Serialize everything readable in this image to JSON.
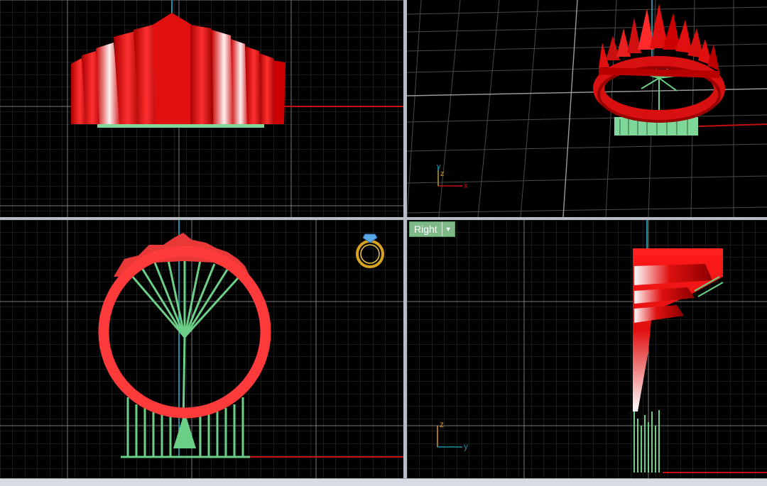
{
  "viewports": {
    "right": {
      "label": "Right",
      "menu_icon": "chevron-down-icon"
    }
  },
  "axis_labels": {
    "perspective": {
      "y": "y",
      "z": "z",
      "x": "x"
    },
    "right": {
      "z": "z",
      "y": "y"
    }
  },
  "colors": {
    "background": "#000000",
    "grid_minor": "#3a3a3a",
    "grid_major": "#8a8a8a",
    "axis_x": "#c21010",
    "axis_y": "#1e8fa0",
    "model_red": "#e01010",
    "support_green": "#7fd89a",
    "label_bg": "#7fb98a"
  }
}
